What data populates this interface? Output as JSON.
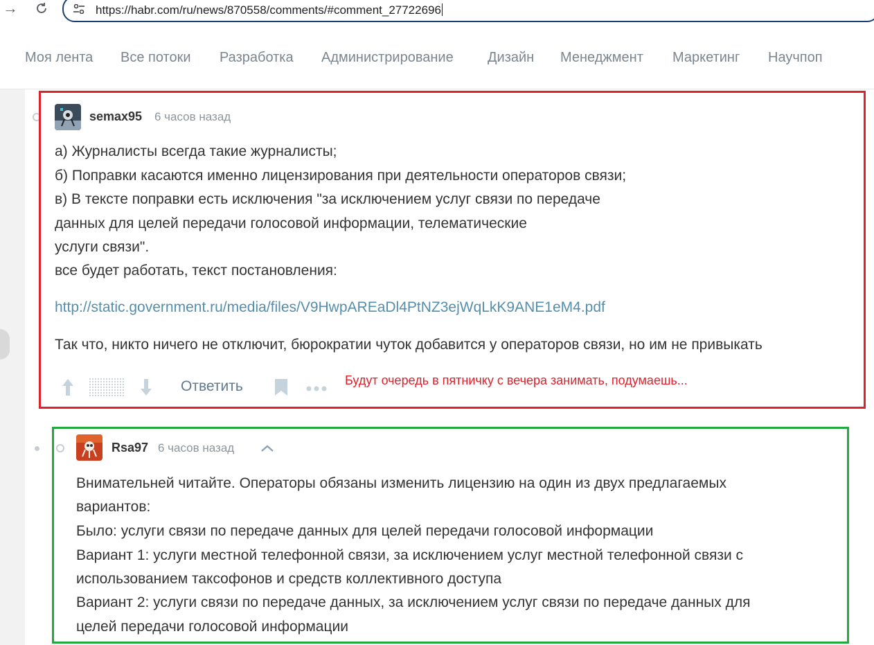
{
  "browser": {
    "url": "https://habr.com/ru/news/870558/comments/#comment_27722696",
    "back_icon": "arrow-right-icon",
    "reload_icon": "reload-icon",
    "site_info_icon": "tune-icon"
  },
  "sitenav": {
    "items": [
      "Моя лента",
      "Все потоки",
      "Разработка",
      "Администрирование",
      "Дизайн",
      "Менеджмент",
      "Маркетинг",
      "Научпоп"
    ]
  },
  "comment1": {
    "username": "semax95",
    "time": "6 часов назад",
    "lines": [
      "а) Журналисты всегда такие журналисты;",
      "б) Поправки касаются именно лицензирования при деятельности операторов связи;",
      "в) В тексте поправки есть исключения \"за исключением услуг связи по передаче",
      "данных для целей передачи голосовой информации, телематические",
      "услуги связи\".",
      "все будет работать, текст постановления:"
    ],
    "link": "http://static.government.ru/media/files/V9HwpAREaDl4PtNZ3ejWqLkK9ANE1eM4.pdf",
    "conclusion": "Так что, никто ничего не отключит, бюрократии чуток добавится у операторов связи, но им не привыкать",
    "actions": {
      "reply_label": "Ответить",
      "icons": [
        "arrow-up-icon",
        "rating-placeholder",
        "arrow-down-icon",
        "bookmark-icon",
        "more-dots-icon"
      ]
    }
  },
  "annotation": {
    "text": "Будут очередь в пятничку с вечера занимать, подумаешь..."
  },
  "comment2": {
    "username": "Rsa97",
    "time": "6 часов назад",
    "collapse_icon": "chevron-up-icon",
    "lines": [
      "Внимательней читайте. Операторы обязаны изменить лицензию на один из двух предлагаемых",
      "вариантов:",
      "Было: услуги связи по передаче данных для целей передачи голосовой информации",
      "Вариант 1: услуги местной телефонной связи, за исключением услуг местной телефонной связи с",
      "использованием таксофонов и средств коллективного доступа",
      "Вариант 2: услуги связи по передаче данных, за исключением услуг связи по передаче данных для",
      "целей передачи голосовой информации"
    ]
  },
  "colors": {
    "highlight_red": "#e0202a",
    "highlight_green": "#1faa3c",
    "link": "#548eaa",
    "nav_text": "#7b858f"
  }
}
